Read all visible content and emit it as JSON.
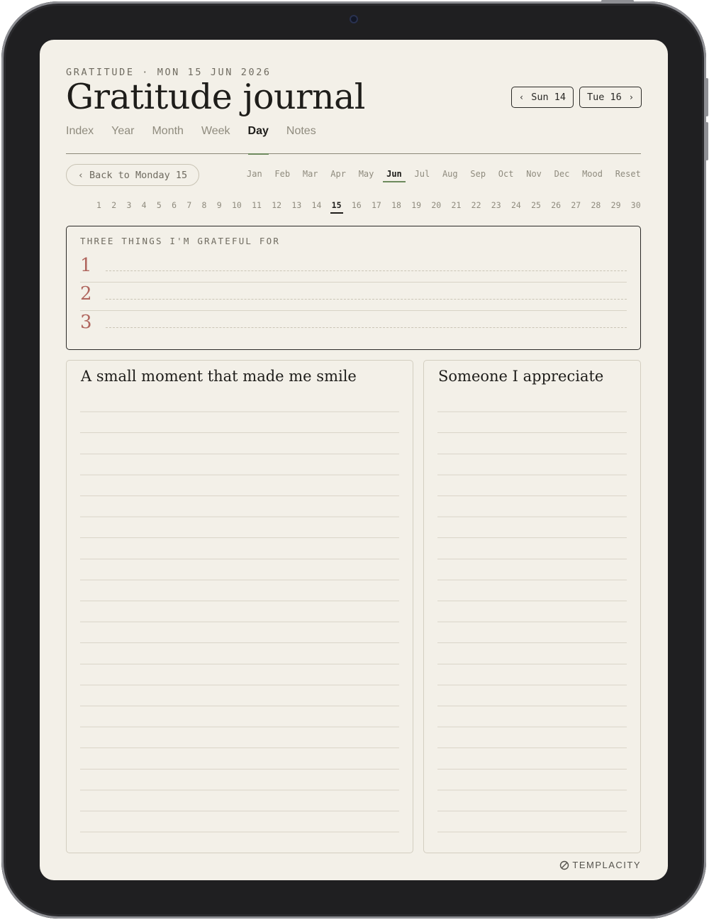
{
  "header": {
    "date_line": "GRATITUDE · MON 15 JUN 2026",
    "title": "Gratitude journal",
    "prev_day": "Sun 14",
    "next_day": "Tue 16"
  },
  "tabs": [
    {
      "label": "Index",
      "active": false
    },
    {
      "label": "Year",
      "active": false
    },
    {
      "label": "Month",
      "active": false
    },
    {
      "label": "Week",
      "active": false
    },
    {
      "label": "Day",
      "active": true
    },
    {
      "label": "Notes",
      "active": false
    }
  ],
  "back_button": "Back to Monday 15",
  "months": [
    "Jan",
    "Feb",
    "Mar",
    "Apr",
    "May",
    "Jun",
    "Jul",
    "Aug",
    "Sep",
    "Oct",
    "Nov",
    "Dec",
    "Mood",
    "Reset"
  ],
  "active_month": "Jun",
  "days": [
    "1",
    "2",
    "3",
    "4",
    "5",
    "6",
    "7",
    "8",
    "9",
    "10",
    "11",
    "12",
    "13",
    "14",
    "15",
    "16",
    "17",
    "18",
    "19",
    "20",
    "21",
    "22",
    "23",
    "24",
    "25",
    "26",
    "27",
    "28",
    "29",
    "30"
  ],
  "active_day": "15",
  "grateful": {
    "label": "THREE THINGS I'M GRATEFUL FOR",
    "numbers": [
      "1",
      "2",
      "3"
    ]
  },
  "panels": {
    "left_title": "A small moment that made me smile",
    "right_title": "Someone I appreciate"
  },
  "brand": "TEMPLACITY",
  "colors": {
    "accent_green": "#6d8a5d",
    "number_red": "#b0665e",
    "paper": "#f3f0e8"
  }
}
